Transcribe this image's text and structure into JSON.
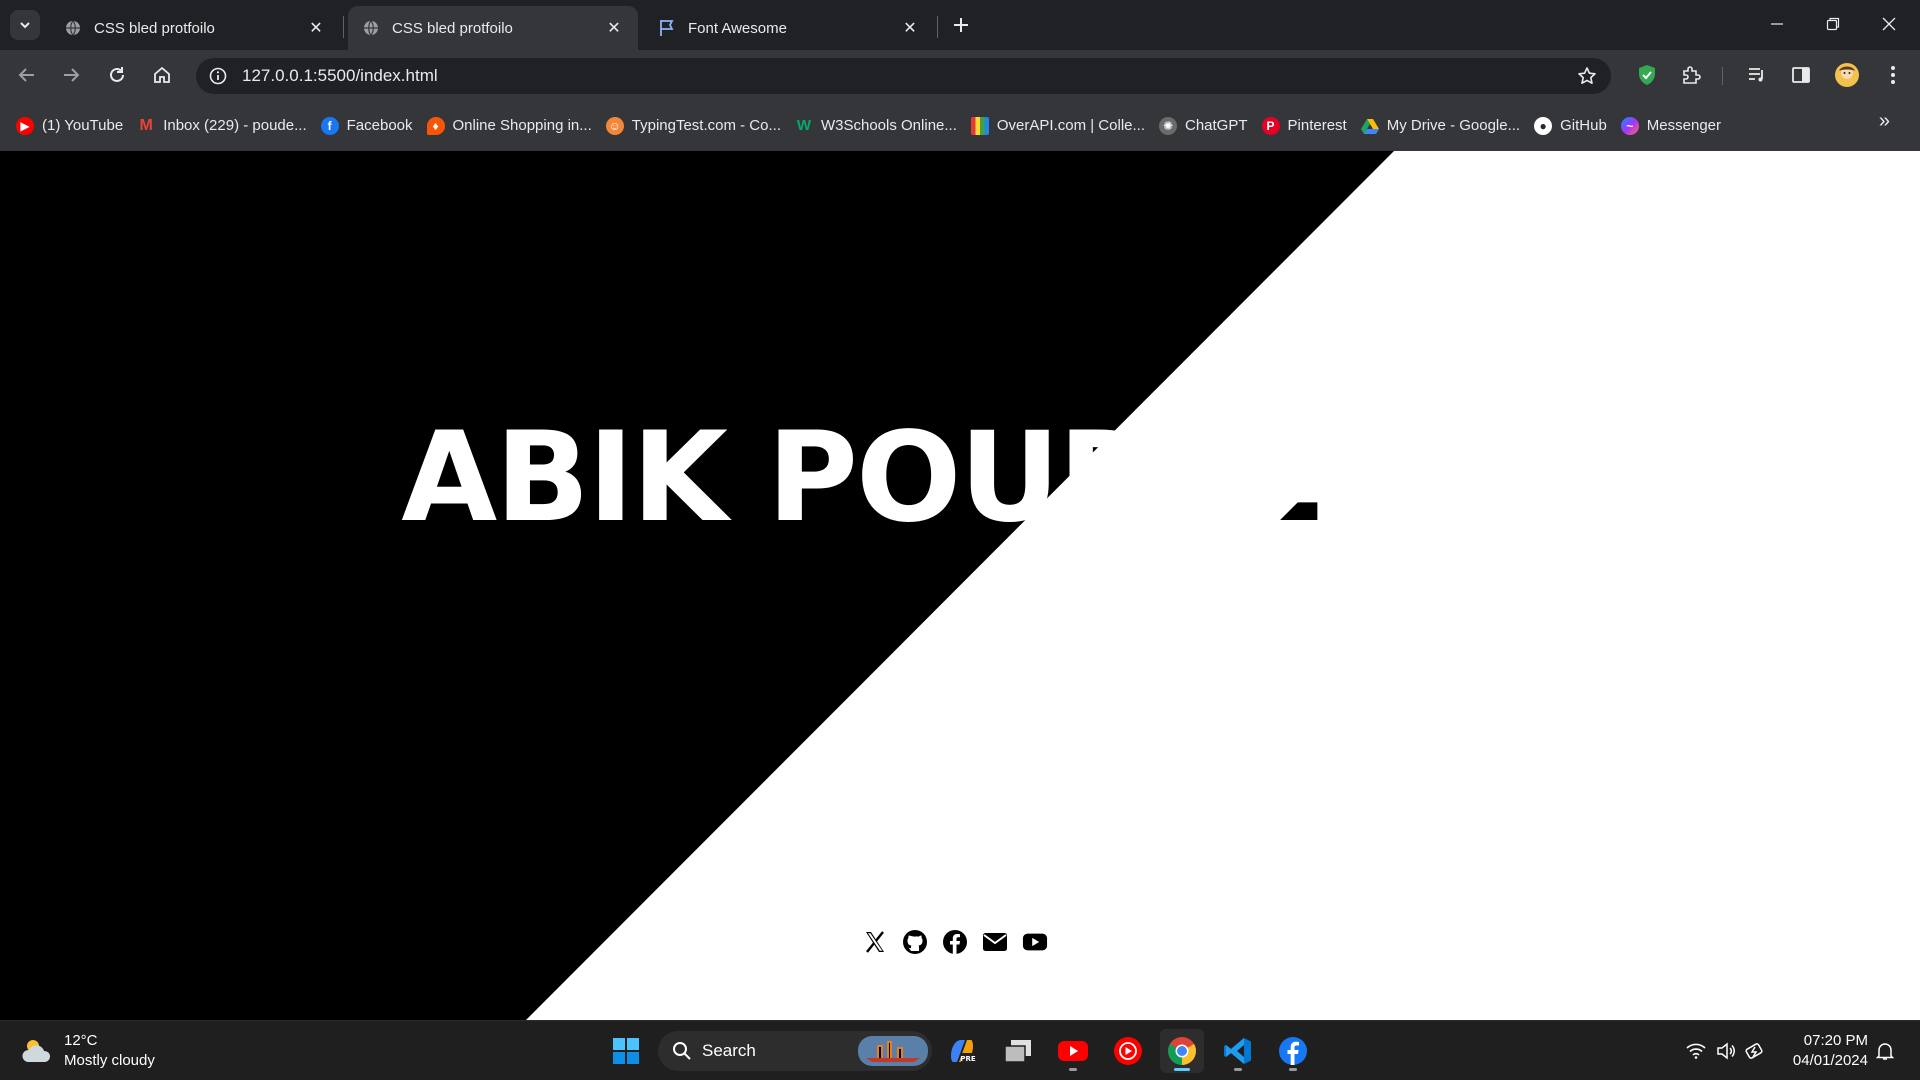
{
  "browser": {
    "tabs": [
      {
        "title": "CSS bled protfoilo",
        "icon": "globe-icon",
        "active": false
      },
      {
        "title": "CSS bled protfoilo",
        "icon": "globe-icon",
        "active": true
      },
      {
        "title": "Font Awesome",
        "icon": "flag-icon",
        "active": false
      }
    ],
    "url": "127.0.0.1:5500/index.html",
    "bookmarks": [
      {
        "label": "(1) YouTube",
        "icon": "youtube-icon",
        "color": "#ff0000"
      },
      {
        "label": "Inbox (229) - poude...",
        "icon": "gmail-icon",
        "color": "#ea4335"
      },
      {
        "label": "Facebook",
        "icon": "facebook-icon",
        "color": "#1877f2"
      },
      {
        "label": "Online Shopping in...",
        "icon": "shopping-icon",
        "color": "#f85606"
      },
      {
        "label": "TypingTest.com - Co...",
        "icon": "typingtest-icon",
        "color": "#f4873a"
      },
      {
        "label": "W3Schools Online...",
        "icon": "w3schools-icon",
        "color": "#04aa6d"
      },
      {
        "label": "OverAPI.com | Colle...",
        "icon": "overapi-icon",
        "color": "#c9a227"
      },
      {
        "label": "ChatGPT",
        "icon": "chatgpt-icon",
        "color": "#6b6b6b"
      },
      {
        "label": "Pinterest",
        "icon": "pinterest-icon",
        "color": "#e60023"
      },
      {
        "label": "My Drive - Google...",
        "icon": "drive-icon",
        "color": "#1fa463"
      },
      {
        "label": "GitHub",
        "icon": "github-icon",
        "color": "#ffffff"
      },
      {
        "label": "Messenger",
        "icon": "messenger-icon",
        "color": "#a334fa"
      }
    ]
  },
  "page": {
    "name": "ABIK POUDEL",
    "split_colors": {
      "left": "#000000",
      "right": "#ffffff"
    },
    "socials": [
      "x-twitter-icon",
      "github-icon",
      "facebook-icon",
      "envelope-icon",
      "youtube-icon"
    ]
  },
  "taskbar": {
    "weather_temp": "12°C",
    "weather_desc": "Mostly cloudy",
    "search_label": "Search",
    "time": "07:20 PM",
    "date": "04/01/2024"
  }
}
